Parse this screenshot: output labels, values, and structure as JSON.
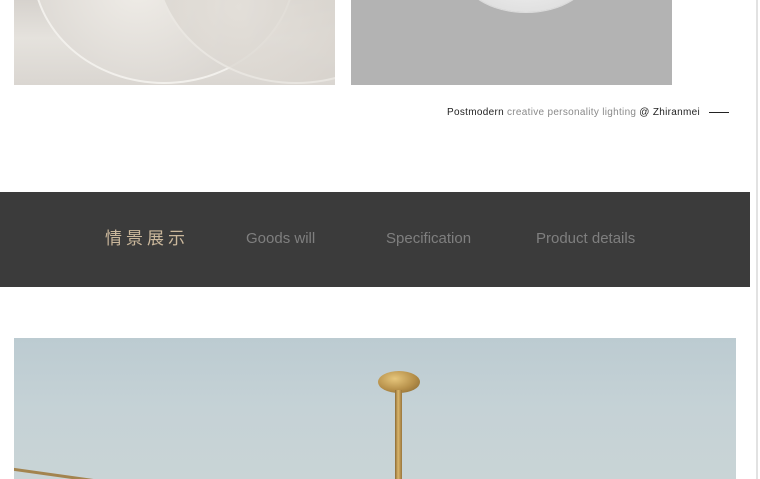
{
  "caption": {
    "brand_word": "Postmodern",
    "description": "creative personality lighting",
    "credit": "@ Zhiranmei"
  },
  "nav": {
    "items": [
      {
        "label": "情景展示",
        "active": true
      },
      {
        "label": "Goods will",
        "active": false
      },
      {
        "label": "Specification",
        "active": false
      },
      {
        "label": "Product details",
        "active": false
      }
    ],
    "band_color": "#3b3b3b",
    "active_color": "#cbb89c",
    "inactive_color": "#7f7f7f"
  },
  "images": [
    {
      "name": "product-photo-orbs"
    },
    {
      "name": "product-photo-disc"
    },
    {
      "name": "scene-photo-brass-pendant"
    }
  ]
}
